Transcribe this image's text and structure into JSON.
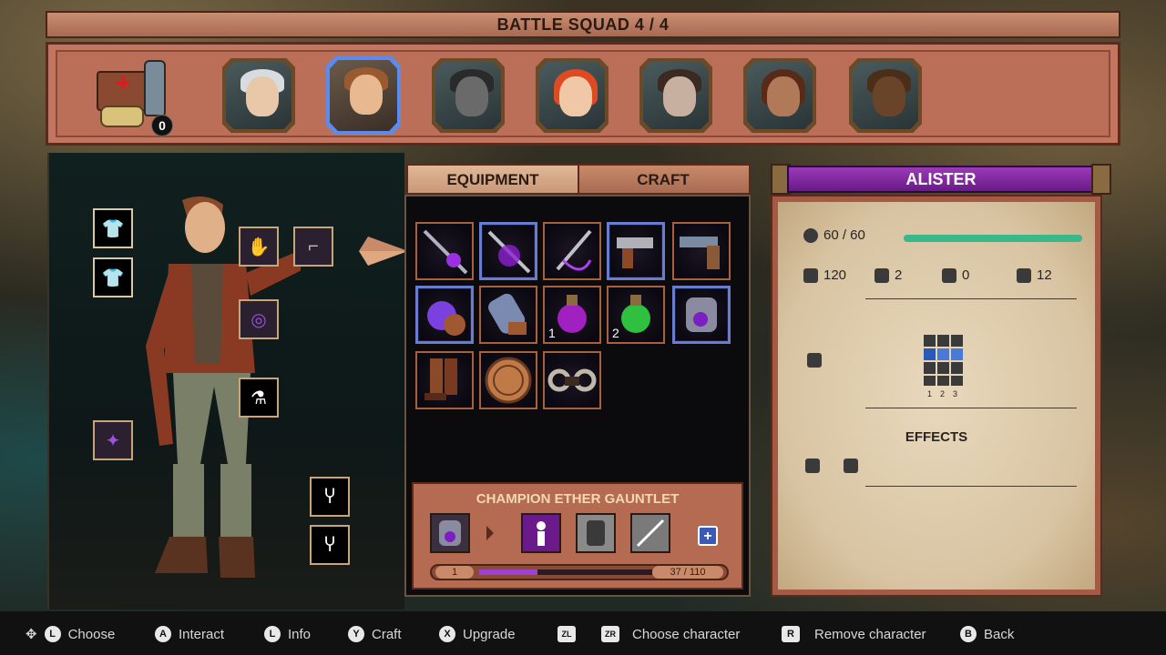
{
  "squad": {
    "title": "BATTLE SQUAD 4 / 4",
    "kit_count": "0",
    "characters": [
      {
        "name": "white-haired-woman",
        "selected": false
      },
      {
        "name": "alister",
        "selected": true
      },
      {
        "name": "badger",
        "selected": false
      },
      {
        "name": "red-haired-woman",
        "selected": false
      },
      {
        "name": "goggles-woman",
        "selected": false
      },
      {
        "name": "dreadlocks-man",
        "selected": false
      },
      {
        "name": "bison",
        "selected": false
      }
    ]
  },
  "tabs": {
    "equipment": "EQUIPMENT",
    "craft": "CRAFT"
  },
  "inventory": {
    "counts": {
      "potion_purple": "1",
      "potion_green": "2"
    }
  },
  "detail": {
    "title": "CHAMPION ETHER GAUNTLET",
    "level": "1",
    "xp": "37 / 110",
    "xp_fraction": 0.336
  },
  "character": {
    "name": "ALISTER",
    "hp": "60 / 60",
    "hp_fraction": 1.0,
    "stats": {
      "attack": "120",
      "armor": "2",
      "resist": "0",
      "move": "12"
    },
    "grid_labels": [
      "1",
      "2",
      "3"
    ],
    "effects_label": "EFFECTS"
  },
  "controls": [
    {
      "key": "L",
      "label": "Choose"
    },
    {
      "key": "A",
      "label": "Interact"
    },
    {
      "key": "L",
      "label": "Info"
    },
    {
      "key": "Y",
      "label": "Craft"
    },
    {
      "key": "X",
      "label": "Upgrade"
    },
    {
      "key": "ZL",
      "label": ""
    },
    {
      "key": "ZR",
      "label": "Choose character"
    },
    {
      "key": "R",
      "label": "Remove character"
    },
    {
      "key": "B",
      "label": "Back"
    }
  ],
  "colors": {
    "accent_purple": "#8a2aa8",
    "selection_blue": "#5a8cf0",
    "hp_green": "#3ab88a"
  }
}
